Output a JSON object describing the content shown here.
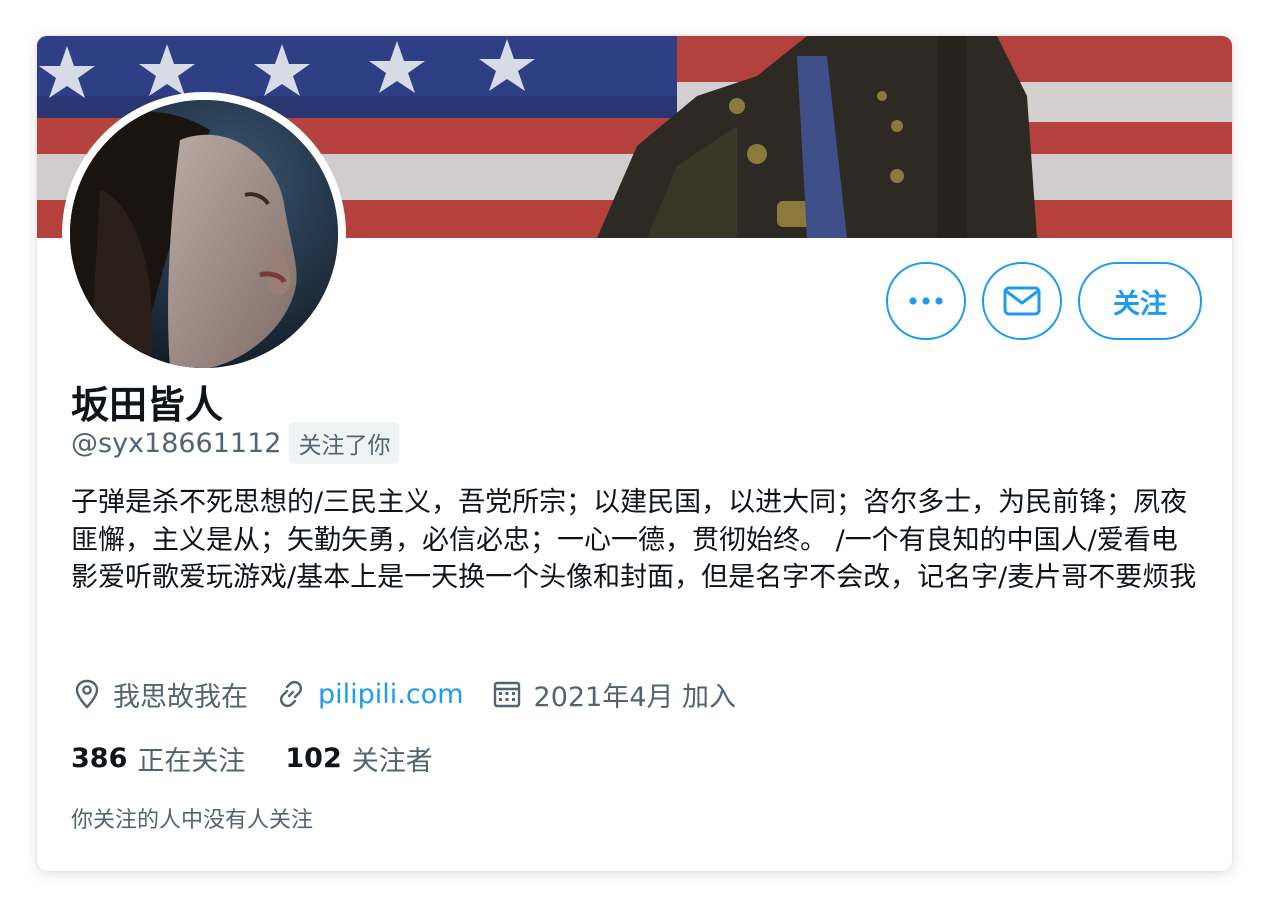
{
  "profile": {
    "display_name": "坂田皆人",
    "handle": "@syx18661112",
    "follows_you_badge": "关注了你",
    "bio": "子弹是杀不死思想的/三民主义，吾党所宗；以建民国，以进大同；咨尔多士，为民前锋；夙夜匪懈，主义是从；矢勤矢勇，必信必忠；一心一德，贯彻始终。 /一个有良知的中国人/爱看电影爱听歌爱玩游戏/基本上是一天换一个头像和封面，但是名字不会改，记名字/麦片哥不要烦我",
    "location": "我思故我在",
    "website": "pilipili.com",
    "joined": "2021年4月 加入"
  },
  "stats": {
    "following_count": "386",
    "following_label": "正在关注",
    "followers_count": "102",
    "followers_label": "关注者"
  },
  "mutual_text": "你关注的人中没有人关注",
  "actions": {
    "follow_label": "关注",
    "more_icon": "more-icon",
    "message_icon": "envelope-icon"
  },
  "colors": {
    "accent": "#1d9bf0",
    "text_primary": "#0f1419",
    "text_secondary": "#536471",
    "badge_bg": "#eff3f4"
  }
}
